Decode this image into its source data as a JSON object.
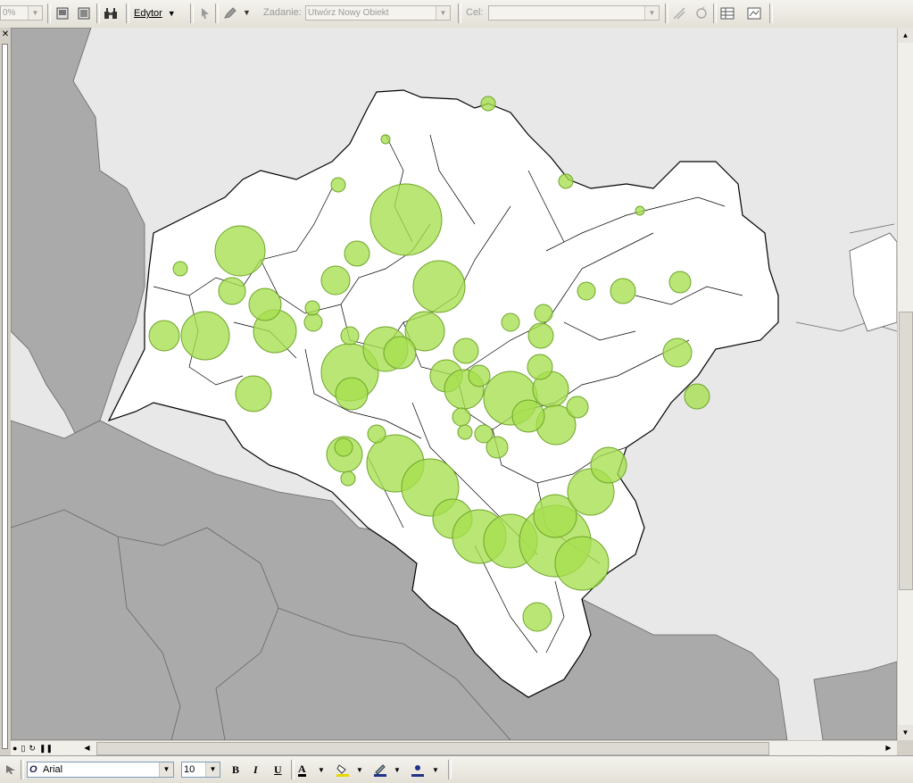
{
  "toolbar": {
    "zoom_value": "0%",
    "editor_label": "Edytor",
    "task_label": "Zadanie:",
    "task_value": "Utwórz Nowy Obiekt",
    "target_label": "Cel:",
    "target_value": ""
  },
  "format_toolbar": {
    "font_name": "Arial",
    "font_size": "10",
    "bold": "B",
    "italic": "I",
    "underline": "U",
    "font_color": "A"
  },
  "colors": {
    "symbol_fill": "#a6df4e",
    "symbol_stroke": "#6fa52a",
    "region_fill": "#ffffff",
    "outer_land_light": "#e8e8e8",
    "outer_land_dark": "#aaaaaa"
  }
}
